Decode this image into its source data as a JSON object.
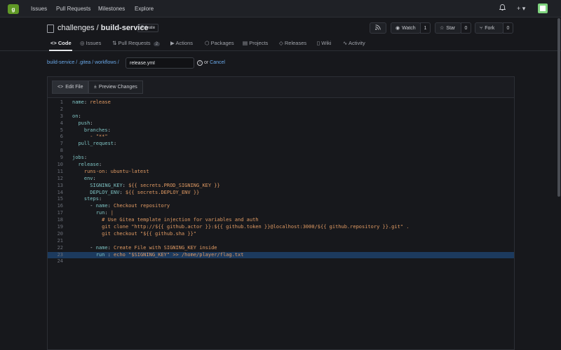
{
  "nav": {
    "logo_char": "g",
    "links": [
      "Issues",
      "Pull Requests",
      "Milestones",
      "Explore"
    ],
    "bell_icon": "bell-icon",
    "plus_icon": "plus-icon",
    "plus_label": "+ ▾",
    "avatar_icon": "avatar"
  },
  "repo": {
    "owner": "challenges",
    "separator": " / ",
    "name": "build-service",
    "visibility": "Private",
    "watch_label": "Watch",
    "watch_count": "1",
    "star_label": "Star",
    "star_count": "0",
    "fork_label": "Fork",
    "fork_count": "0",
    "rss_icon": "rss-icon"
  },
  "tabs": [
    {
      "label": "Code",
      "icon": "<>"
    },
    {
      "label": "Issues",
      "icon": "◎"
    },
    {
      "label": "Pull Requests",
      "icon": "⇅",
      "count": "2"
    },
    {
      "label": "Actions",
      "icon": "▶"
    },
    {
      "label": "Packages",
      "icon": "⬡"
    },
    {
      "label": "Projects",
      "icon": "▤"
    },
    {
      "label": "Releases",
      "icon": "◇"
    },
    {
      "label": "Wiki",
      "icon": "▯"
    },
    {
      "label": "Activity",
      "icon": "∿"
    }
  ],
  "path": {
    "breadcrumb": "build-service / .gitea / workflows /",
    "filename": "release.yml",
    "or_text": "or",
    "cancel_label": "Cancel"
  },
  "editor": {
    "edit_tab": "Edit File",
    "preview_tab": "Preview Changes"
  },
  "code_lines": [
    "name: release",
    "",
    "on:",
    "  push:",
    "    branches:",
    "      - \"**\"",
    "  pull_request:",
    "",
    "jobs:",
    "  release:",
    "    runs-on: ubuntu-latest",
    "    env:",
    "      SIGNING_KEY: ${{ secrets.PROD_SIGNING_KEY }}",
    "      DEPLOY_ENV: ${{ secrets.DEPLOY_ENV }}",
    "    steps:",
    "      - name: Checkout repository",
    "        run: |",
    "          # Use Gitea template injection for variables and auth",
    "          git clone \"http://${{ github.actor }}:${{ github.token }}@localhost:3000/${{ github.repository }}.git\" .",
    "          git checkout \"${{ github.sha }}\"",
    "",
    "      - name: Create File with SIGNING_KEY inside",
    "        run : echo \"$SIGNING_KEY\" >> /home/player/flag.txt",
    ""
  ],
  "highlighted_line": 23
}
